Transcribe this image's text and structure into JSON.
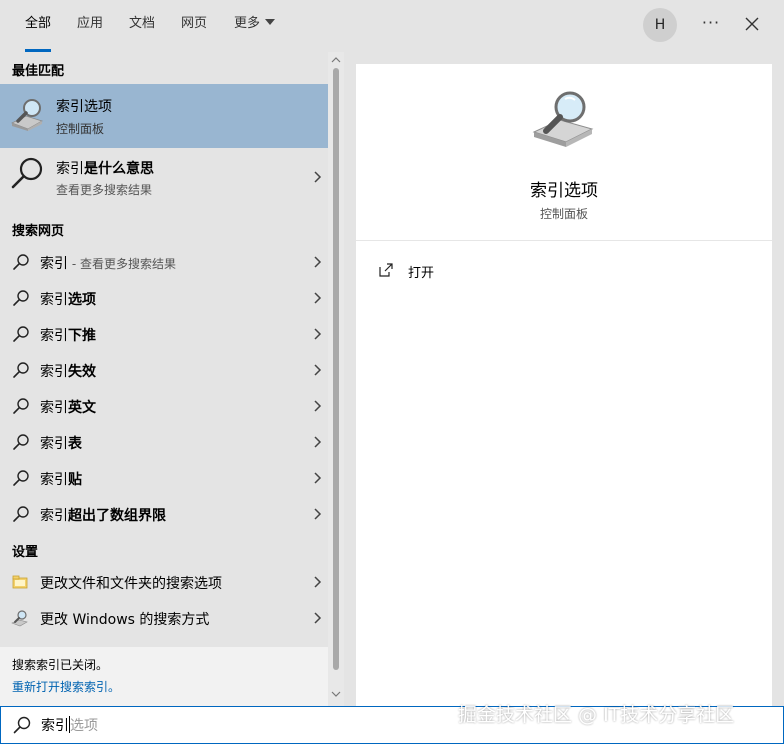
{
  "tabs": [
    {
      "label": "全部",
      "active": true
    },
    {
      "label": "应用"
    },
    {
      "label": "文档"
    },
    {
      "label": "网页"
    },
    {
      "label": "更多"
    }
  ],
  "header": {
    "avatar_initial": "H",
    "more_icon": "more-dots-icon",
    "close_icon": "close-icon"
  },
  "left": {
    "best_match_title": "最佳匹配",
    "best_match": {
      "title": "索引选项",
      "subtitle": "控制面板",
      "icon": "indexing-options-icon"
    },
    "web_top": {
      "title_bold": "索引是什么意思",
      "title_regular_prefix": "索引",
      "subtitle": "查看更多搜索结果"
    },
    "search_web_title": "搜索网页",
    "web_results": [
      {
        "prefix": "索引",
        "suffix": "",
        "sub": " - 查看更多搜索结果"
      },
      {
        "prefix": "索引",
        "suffix": "选项",
        "sub": ""
      },
      {
        "prefix": "索引",
        "suffix": "下推",
        "sub": ""
      },
      {
        "prefix": "索引",
        "suffix": "失效",
        "sub": ""
      },
      {
        "prefix": "索引",
        "suffix": "英文",
        "sub": ""
      },
      {
        "prefix": "索引",
        "suffix": "表",
        "sub": ""
      },
      {
        "prefix": "索引",
        "suffix": "贴",
        "sub": ""
      },
      {
        "prefix": "索引",
        "suffix": "超出了数组界限",
        "sub": ""
      }
    ],
    "settings_title": "设置",
    "settings_items": [
      {
        "label": "更改文件和文件夹的搜索选项",
        "icon": "folder-options-icon"
      },
      {
        "label": "更改 Windows 的搜索方式",
        "icon": "search-settings-icon"
      }
    ]
  },
  "status": {
    "line1": "搜索索引已关闭。",
    "link": "重新打开搜索索引。"
  },
  "preview": {
    "title": "索引选项",
    "subtitle": "控制面板",
    "open_label": "打开"
  },
  "search": {
    "typed": "索引",
    "suggestion": "选项"
  },
  "watermark": "掘金技术社区 @ IT技术分享社区",
  "colors": {
    "accent": "#0067c0",
    "selected": "#99b6d1",
    "link": "#0063b1"
  }
}
